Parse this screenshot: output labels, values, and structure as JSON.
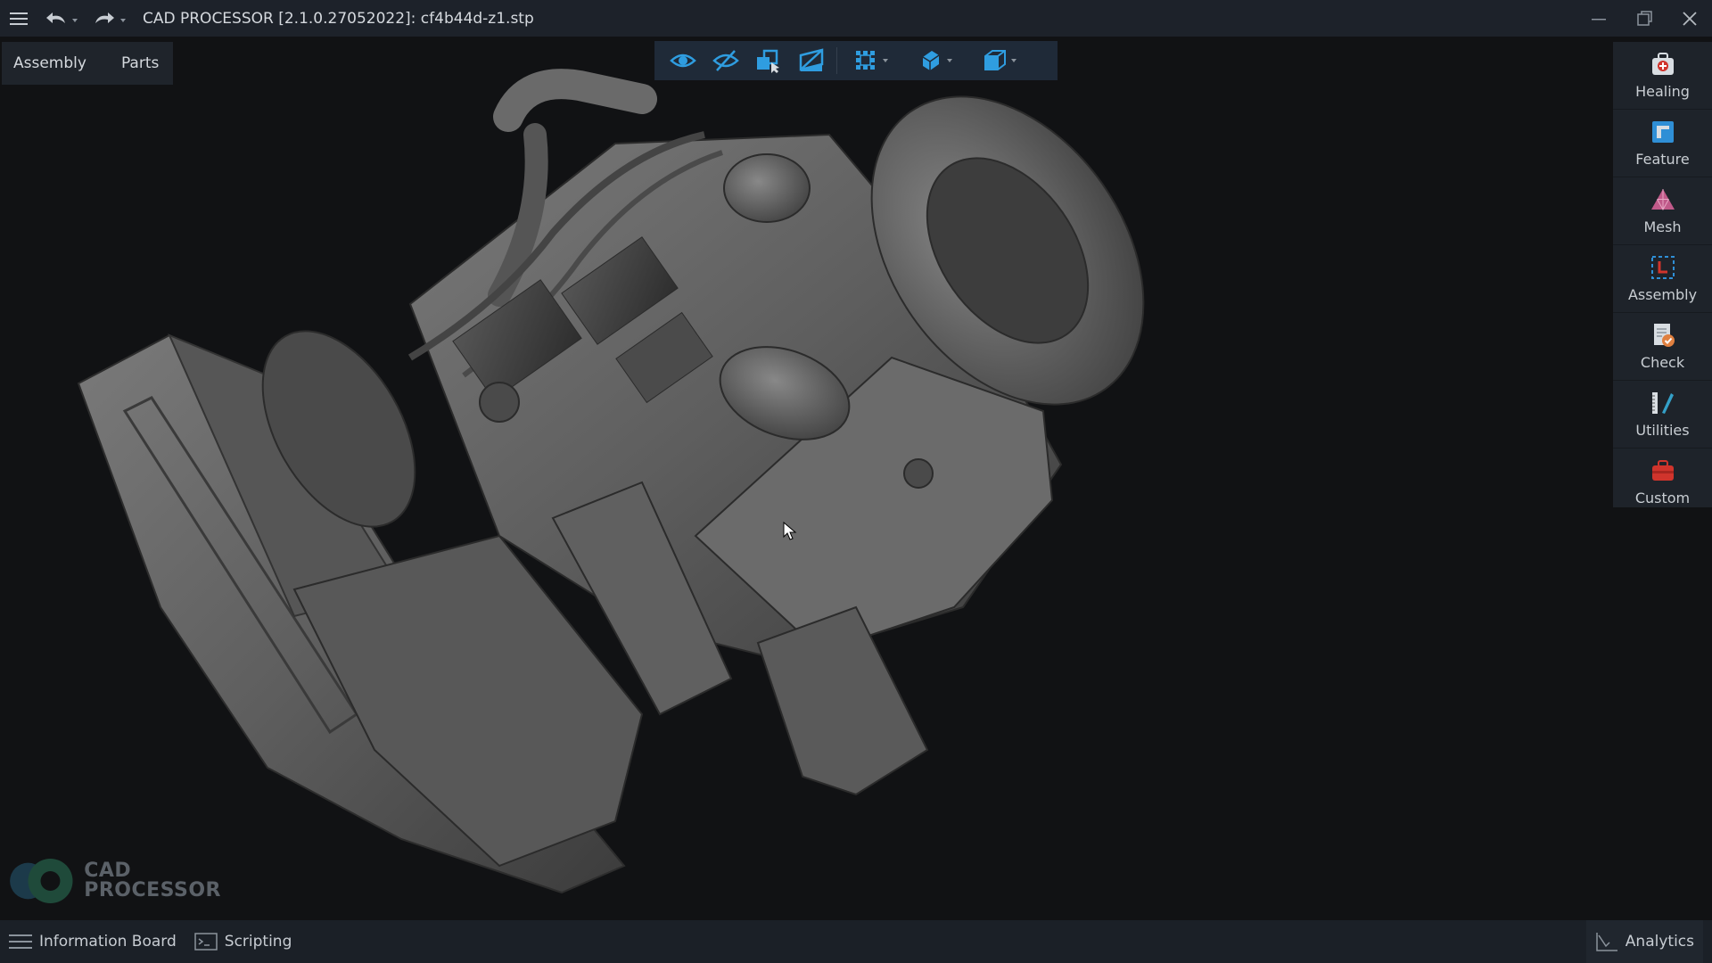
{
  "window": {
    "title": "CAD PROCESSOR [2.1.0.27052022]:  cf4b44d-z1.stp"
  },
  "view_tabs": [
    "Assembly",
    "Parts"
  ],
  "toolbar": {
    "icons": [
      "eye-icon",
      "eye-off-icon",
      "select-parts-icon",
      "clip-plane-icon",
      "grid-menu-icon",
      "display-mode-icon",
      "view-cube-icon"
    ],
    "accent": "#2f9de0"
  },
  "right_panel": {
    "items": [
      {
        "label": "Healing",
        "icon": "healing-icon",
        "color": "#d8dde2"
      },
      {
        "label": "Feature",
        "icon": "feature-icon",
        "color": "#2f8fd6"
      },
      {
        "label": "Mesh",
        "icon": "mesh-icon",
        "color": "#c05a8a"
      },
      {
        "label": "Assembly",
        "icon": "assembly-icon",
        "color": "#2f8fd6"
      },
      {
        "label": "Check",
        "icon": "check-icon",
        "color": "#e08040"
      },
      {
        "label": "Utilities",
        "icon": "utilities-icon",
        "color": "#34a0c8"
      },
      {
        "label": "Custom",
        "icon": "custom-icon",
        "color": "#d0342c"
      }
    ]
  },
  "logo": {
    "line1": "CAD",
    "line2": "PROCESSOR"
  },
  "bottombar": {
    "information_board": "Information Board",
    "scripting": "Scripting",
    "analytics": "Analytics"
  }
}
